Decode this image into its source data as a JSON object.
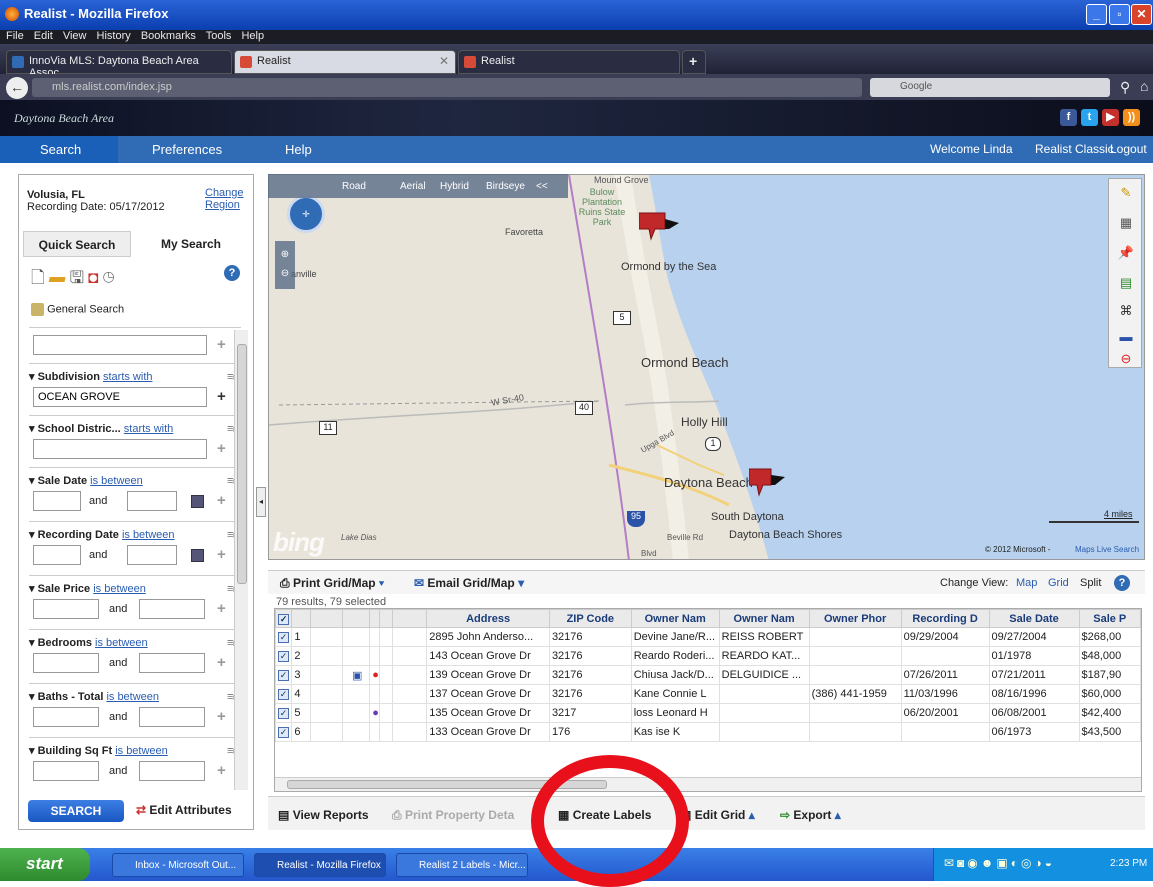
{
  "window": {
    "title": "Realist - Mozilla Firefox"
  },
  "menu": [
    "File",
    "Edit",
    "View",
    "History",
    "Bookmarks",
    "Tools",
    "Help"
  ],
  "tabs": [
    {
      "label": "InnoVia MLS: Daytona Beach Area Assoc..."
    },
    {
      "label": "Realist"
    },
    {
      "label": "Realist"
    }
  ],
  "url": "mls.realist.com/index.jsp",
  "search_engine": "Google",
  "brand": "Daytona Beach Area",
  "nav": {
    "search": "Search",
    "preferences": "Preferences",
    "help": "Help",
    "welcome": "Welcome Linda",
    "classic": "Realist Classic",
    "logout": "Logout"
  },
  "region": {
    "name": "Volusia, FL",
    "recording_date": "Recording Date: 05/17/2012",
    "change": "Change",
    "region": "Region"
  },
  "search_tabs": {
    "quick": "Quick Search",
    "my": "My Search"
  },
  "general_search": "General Search",
  "filters": {
    "subdivision": {
      "label": "Subdivision",
      "op": "starts with",
      "value": "OCEAN GROVE"
    },
    "school": {
      "label": "School Distric...",
      "op": "starts with"
    },
    "sale_date": {
      "label": "Sale Date",
      "op": "is between"
    },
    "recording_date": {
      "label": "Recording Date",
      "op": "is between"
    },
    "sale_price": {
      "label": "Sale Price",
      "op": "is between"
    },
    "bedrooms": {
      "label": "Bedrooms",
      "op": "is between"
    },
    "baths": {
      "label": "Baths - Total",
      "op": "is between"
    },
    "sqft": {
      "label": "Building Sq Ft",
      "op": "is between"
    },
    "and": "and"
  },
  "buttons": {
    "search": "SEARCH",
    "edit_attributes": "Edit Attributes"
  },
  "map": {
    "types": [
      "Road",
      "Aerial",
      "Hybrid",
      "Birdseye"
    ],
    "collapse": "<<",
    "places": {
      "mound": "Mound Grove",
      "bulow": "Bulow Plantation Ruins State Park",
      "favoretta": "Favoretta",
      "ormond_sea": "Ormond by the Sea",
      "ormond_beach": "Ormond Beach",
      "holly": "Holly Hill",
      "daytona": "Daytona Beach",
      "south_daytona": "South Daytona",
      "shores": "Daytona Beach Shores",
      "sr40": "W Sr-40",
      "bunnell": "anville",
      "beville": "Beville Rd",
      "lake": "Lake Dias",
      "blvd": "Blvd",
      "upga": "Upga Blvd"
    },
    "shields": [
      "5",
      "40",
      "11",
      "1",
      "95"
    ],
    "scale": "4 miles",
    "copyright": "© 2012 Microsoft -",
    "copyright_link": "Maps Live Search",
    "bing": "bing"
  },
  "grid_toolbar": {
    "print": "Print Grid/Map",
    "email": "Email Grid/Map",
    "change_view": "Change View:",
    "map": "Map",
    "grid": "Grid",
    "split": "Split"
  },
  "results": "79 results, 79 selected",
  "columns": [
    "Address",
    "ZIP Code",
    "Owner Nam",
    "Owner Nam",
    "Owner Phor",
    "Recording D",
    "Sale Date",
    "Sale P"
  ],
  "rows": [
    {
      "n": "1",
      "address": "2895 John Anderso...",
      "zip": "32176",
      "owner1": "Devine Jane/R...",
      "owner2": "REISS ROBERT",
      "phone": "",
      "rec": "09/29/2004",
      "sale": "09/27/2004",
      "price": "$268,00"
    },
    {
      "n": "2",
      "address": "143 Ocean Grove Dr",
      "zip": "32176",
      "owner1": "Reardo Roderi...",
      "owner2": "REARDO KAT...",
      "phone": "",
      "rec": "",
      "sale": "01/1978",
      "price": "$48,000"
    },
    {
      "n": "3",
      "address": "139 Ocean Grove Dr",
      "zip": "32176",
      "owner1": "Chiusa Jack/D...",
      "owner2": "DELGUIDICE ...",
      "phone": "",
      "rec": "07/26/2011",
      "sale": "07/21/2011",
      "price": "$187,90"
    },
    {
      "n": "4",
      "address": "137 Ocean Grove Dr",
      "zip": "32176",
      "owner1": "Kane Connie L",
      "owner2": "",
      "phone": "(386) 441-1959",
      "rec": "11/03/1996",
      "sale": "08/16/1996",
      "price": "$60,000"
    },
    {
      "n": "5",
      "address": "135 Ocean Grove Dr",
      "zip": "3217",
      "owner1": "loss Leonard H",
      "owner2": "",
      "phone": "",
      "rec": "06/20/2001",
      "sale": "06/08/2001",
      "price": "$42,400"
    },
    {
      "n": "6",
      "address": "133 Ocean Grove Dr",
      "zip": "176",
      "owner1": "Kas   ise K",
      "owner2": "",
      "phone": "",
      "rec": "",
      "sale": "06/1973",
      "price": "$43,500"
    }
  ],
  "bottom": {
    "view_reports": "View Reports",
    "print_details": "Print Property Deta",
    "create_labels": "Create Labels",
    "edit_grid": "Edit Grid",
    "export": "Export"
  },
  "taskbar": {
    "start": "start",
    "items": [
      "Inbox - Microsoft Out...",
      "Realist - Mozilla Firefox",
      "Realist 2 Labels - Micr..."
    ],
    "time": "2:23 PM"
  },
  "colors": {
    "nav": "#2f6cb5",
    "accent_red": "#e8101a",
    "marker": "#c0282a"
  }
}
